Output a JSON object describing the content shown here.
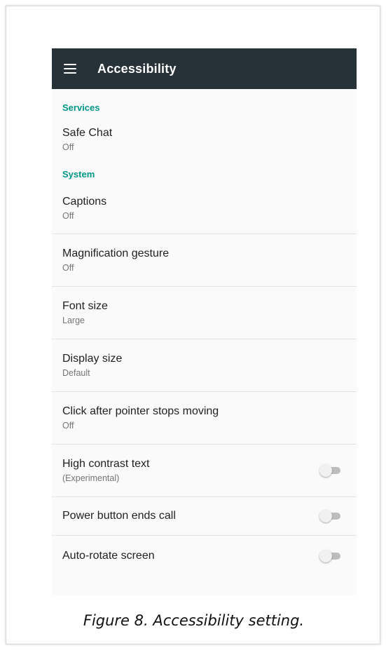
{
  "toolbar": {
    "title": "Accessibility",
    "menu_icon": "hamburger-menu-icon"
  },
  "sections": {
    "services": {
      "header": "Services"
    },
    "system": {
      "header": "System"
    }
  },
  "items": {
    "safe_chat": {
      "title": "Safe Chat",
      "summary": "Off"
    },
    "captions": {
      "title": "Captions",
      "summary": "Off"
    },
    "magnification": {
      "title": "Magnification gesture",
      "summary": "Off"
    },
    "font_size": {
      "title": "Font size",
      "summary": "Large"
    },
    "display_size": {
      "title": "Display size",
      "summary": "Default"
    },
    "click_after_pointer": {
      "title": "Click after pointer stops moving",
      "summary": "Off"
    },
    "high_contrast": {
      "title": "High contrast text",
      "summary": "(Experimental)",
      "toggle_on": false
    },
    "power_button": {
      "title": "Power button ends call",
      "toggle_on": false
    },
    "auto_rotate": {
      "title": "Auto-rotate screen",
      "toggle_on": false
    }
  },
  "caption": "Figure 8. Accessibility setting.",
  "colors": {
    "toolbar": "#263238",
    "accent": "#009688",
    "background": "#fafafa"
  }
}
